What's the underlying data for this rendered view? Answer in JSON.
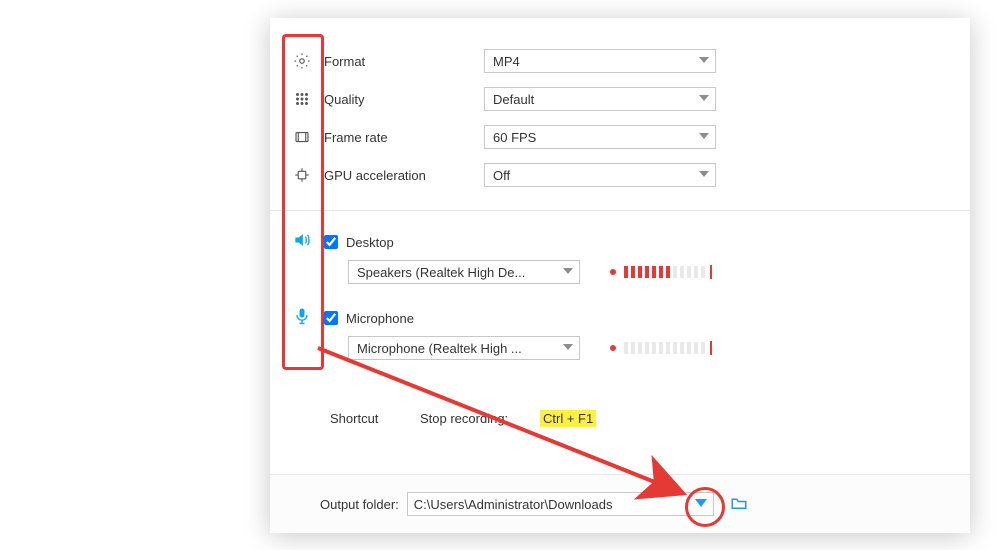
{
  "settings": {
    "format": {
      "label": "Format",
      "value": "MP4"
    },
    "quality": {
      "label": "Quality",
      "value": "Default"
    },
    "frame_rate": {
      "label": "Frame rate",
      "value": "60 FPS"
    },
    "gpu": {
      "label": "GPU acceleration",
      "value": "Off"
    }
  },
  "audio": {
    "desktop": {
      "label": "Desktop",
      "checked": true,
      "device": "Speakers (Realtek High De...",
      "level": 7,
      "total_bars": 12
    },
    "mic": {
      "label": "Microphone",
      "checked": true,
      "device": "Microphone (Realtek High ...",
      "level": 0,
      "total_bars": 12
    }
  },
  "shortcut": {
    "label": "Shortcut",
    "action": "Stop recording:",
    "hotkey": "Ctrl + F1"
  },
  "output": {
    "label": "Output folder:",
    "path": "C:\\Users\\Administrator\\Downloads"
  }
}
